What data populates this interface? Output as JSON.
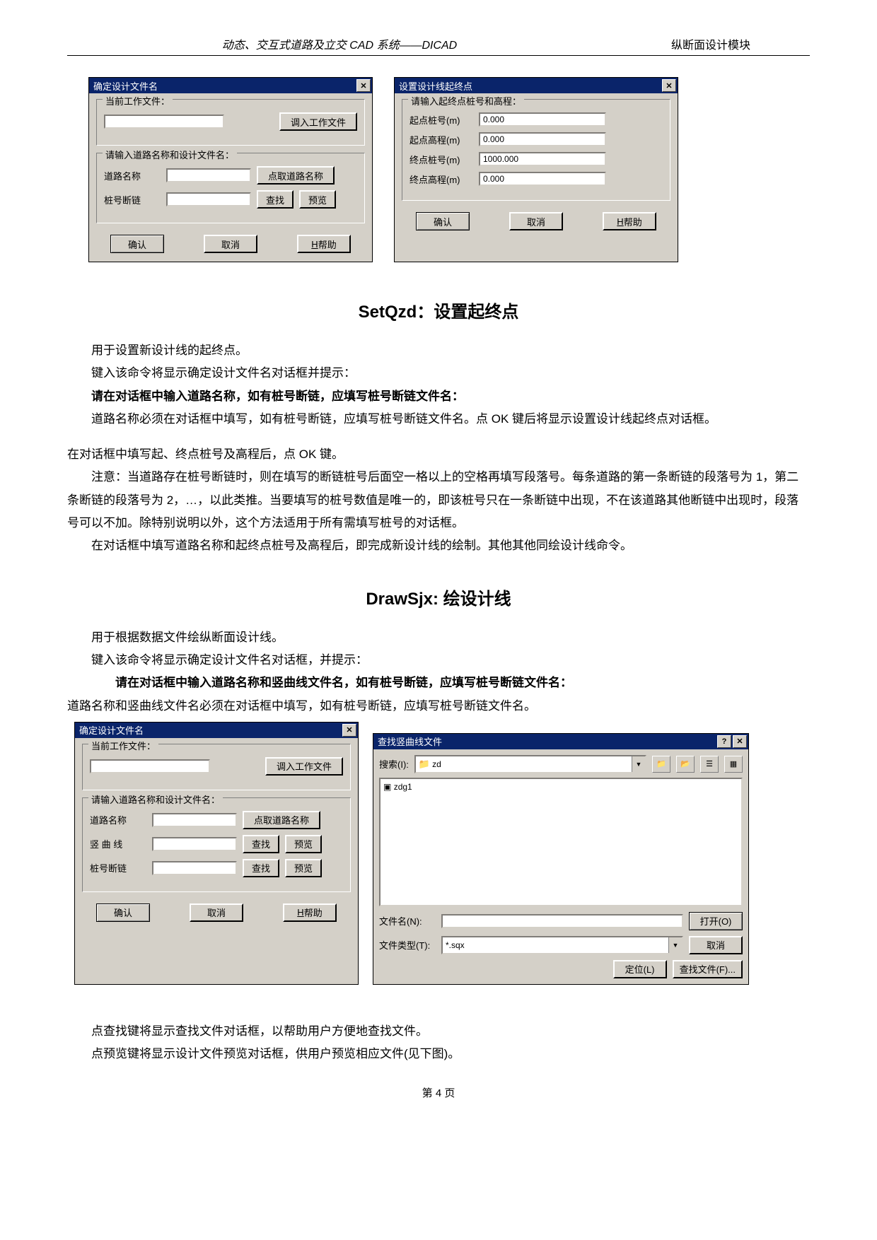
{
  "header": {
    "left": "动态、交互式道路及立交 CAD 系统——DICAD",
    "right": "纵断面设计模块"
  },
  "dlg1": {
    "title": "确定设计文件名",
    "grp1_legend": "当前工作文件：",
    "btn_load": "调入工作文件",
    "grp2_legend": "请输入道路名称和设计文件名：",
    "lbl_road": "道路名称",
    "btn_pick": "点取道路名称",
    "lbl_zh": "桩号断链",
    "btn_find": "查找",
    "btn_preview": "预览",
    "ok": "确认",
    "cancel": "取消",
    "help": "H帮助",
    "val_work": "",
    "val_road": "",
    "val_zh": ""
  },
  "dlg2": {
    "title": "设置设计线起终点",
    "grp_legend": "请输入起终点桩号和高程：",
    "lbl_sz": "起点桩号(m)",
    "lbl_sg": "起点高程(m)",
    "lbl_ez": "终点桩号(m)",
    "lbl_eg": "终点高程(m)",
    "v_sz": "0.000",
    "v_sg": "0.000",
    "v_ez": "1000.000",
    "v_eg": "0.000",
    "ok": "确认",
    "cancel": "取消",
    "help": "H帮助"
  },
  "sec1": {
    "h": "SetQzd：设置起终点",
    "p1": "用于设置新设计线的起终点。",
    "p2": "键入该命令将显示确定设计文件名对话框并提示：",
    "p3": "请在对话框中输入道路名称，如有桩号断链，应填写桩号断链文件名：",
    "p4": "道路名称必须在对话框中填写，如有桩号断链，应填写桩号断链文件名。点 OK 键后将显示设置设计线起终点对话框。",
    "p5": "在对话框中填写起、终点桩号及高程后，点 OK 键。",
    "p6": "注意：当道路存在桩号断链时，则在填写的断链桩号后面空一格以上的空格再填写段落号。每条道路的第一条断链的段落号为 1，第二条断链的段落号为 2，…，以此类推。当要填写的桩号数值是唯一的，即该桩号只在一条断链中出现，不在该道路其他断链中出现时，段落号可以不加。除特别说明以外，这个方法适用于所有需填写桩号的对话框。",
    "p7": "在对话框中填写道路名称和起终点桩号及高程后，即完成新设计线的绘制。其他其他同绘设计线命令。"
  },
  "sec2": {
    "h": "DrawSjx: 绘设计线",
    "p1": "用于根据数据文件绘纵断面设计线。",
    "p2": "键入该命令将显示确定设计文件名对话框，并提示：",
    "p3": "请在对话框中输入道路名称和竖曲线文件名，如有桩号断链，应填写桩号断链文件名：",
    "p4": "道路名称和竖曲线文件名必须在对话框中填写，如有桩号断链，应填写桩号断链文件名。"
  },
  "dlg3": {
    "title": "确定设计文件名",
    "grp1_legend": "当前工作文件：",
    "btn_load": "调入工作文件",
    "grp2_legend": "请输入道路名称和设计文件名：",
    "lbl_road": "道路名称",
    "btn_pick": "点取道路名称",
    "lbl_sqx": "竖 曲 线",
    "lbl_zh": "桩号断链",
    "btn_find": "查找",
    "btn_preview": "预览",
    "ok": "确认",
    "cancel": "取消",
    "help": "H帮助"
  },
  "dlg4": {
    "title": "查找竖曲线文件",
    "lbl_search": "搜索(I):",
    "folder": "zd",
    "item": "zdg1",
    "lbl_name": "文件名(N):",
    "lbl_type": "文件类型(T):",
    "type_val": "*.sqx",
    "btn_open": "打开(O)",
    "btn_cancel": "取消",
    "btn_locate": "定位(L)",
    "btn_find": "查找文件(F)..."
  },
  "sec3": {
    "p1": "点查找键将显示查找文件对话框，以帮助用户方便地查找文件。",
    "p2": "点预览键将显示设计文件预览对话框，供用户预览相应文件(见下图)。"
  },
  "footer": "第 4 页"
}
